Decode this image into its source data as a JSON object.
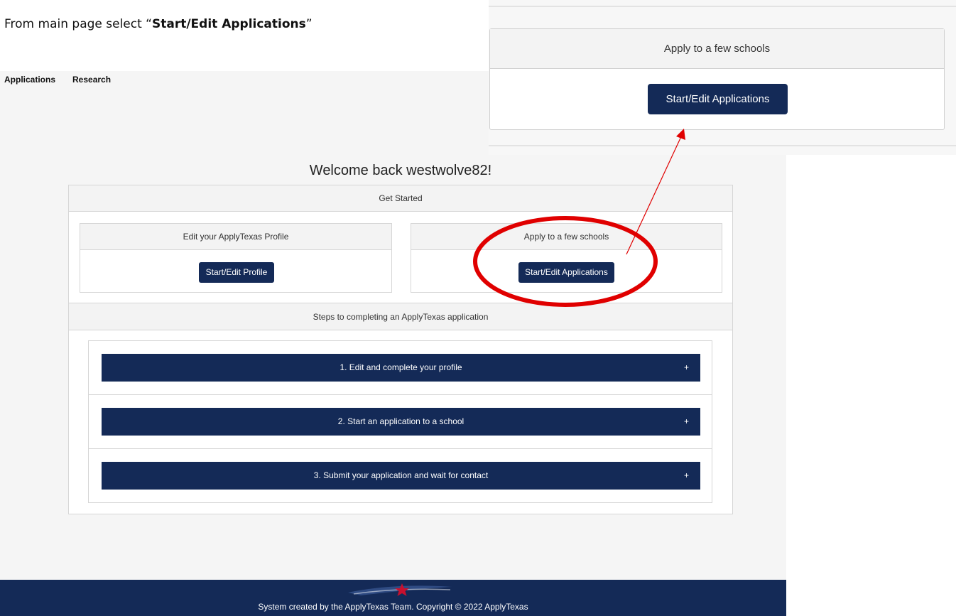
{
  "instruction": {
    "prefix": "From main page select “",
    "bold": "Start/Edit Applications",
    "suffix": "”"
  },
  "nav": {
    "items": [
      "Applications",
      "Research"
    ]
  },
  "welcome": "Welcome back westwolve82!",
  "get_started": {
    "title": "Get Started",
    "profile_card": {
      "title": "Edit your ApplyTexas Profile",
      "button": "Start/Edit Profile"
    },
    "apply_card": {
      "title": "Apply to a few schools",
      "button": "Start/Edit Applications"
    }
  },
  "steps": {
    "title": "Steps to completing an ApplyTexas application",
    "items": [
      "1. Edit and complete your profile",
      "2. Start an application to a school",
      "3. Submit your application and wait for contact"
    ],
    "expand_symbol": "+"
  },
  "footer": {
    "text": "System created by the ApplyTexas Team. Copyright © 2022 ApplyTexas"
  },
  "zoom": {
    "title": "Apply to a few schools",
    "button": "Start/Edit Applications"
  },
  "colors": {
    "navy": "#142a57",
    "annotation_red": "#e00000"
  }
}
